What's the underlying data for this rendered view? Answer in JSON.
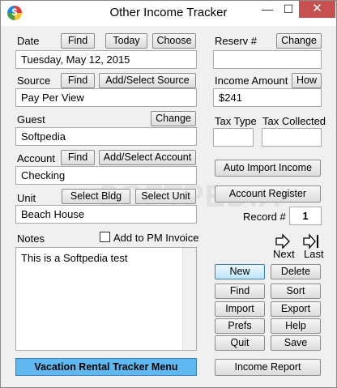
{
  "window": {
    "title": "Other Income Tracker",
    "min": "—",
    "max": "☐",
    "close": "✕"
  },
  "date": {
    "label": "Date",
    "find": "Find",
    "today": "Today",
    "choose": "Choose",
    "value": "Tuesday, May 12, 2015"
  },
  "source": {
    "label": "Source",
    "find": "Find",
    "add": "Add/Select Source",
    "value": "Pay Per View"
  },
  "guest": {
    "label": "Guest",
    "change": "Change",
    "value": "Softpedia"
  },
  "account": {
    "label": "Account",
    "find": "Find",
    "add": "Add/Select Account",
    "value": "Checking"
  },
  "unit": {
    "label": "Unit",
    "select_bldg": "Select Bldg",
    "select_unit": "Select Unit",
    "value": "Beach House"
  },
  "notes": {
    "label": "Notes",
    "add_pm_label": "Add to PM Invoice",
    "value": "This is a Softpedia test"
  },
  "reserv": {
    "label": "Reserv #",
    "change": "Change",
    "value": ""
  },
  "income_amount": {
    "label": "Income Amount",
    "how": "How",
    "value": "$241"
  },
  "tax_type": {
    "label": "Tax Type",
    "value": ""
  },
  "tax_collected": {
    "label": "Tax Collected",
    "value": ""
  },
  "auto_import": "Auto Import Income",
  "account_register": "Account Register",
  "record": {
    "label": "Record #",
    "value": "1"
  },
  "nav": {
    "next": "Next",
    "last": "Last"
  },
  "actions": {
    "new": "New",
    "delete": "Delete",
    "find": "Find",
    "sort": "Sort",
    "import": "Import",
    "export": "Export",
    "prefs": "Prefs",
    "help": "Help",
    "quit": "Quit",
    "save": "Save"
  },
  "vacation_menu": "Vacation Rental Tracker Menu",
  "income_report": "Income Report",
  "watermark": "SOFTPEDIA",
  "colors": {
    "menu_button": "#5fb8ef",
    "close_button": "#c75050",
    "window_bg": "#f0f0f0"
  }
}
